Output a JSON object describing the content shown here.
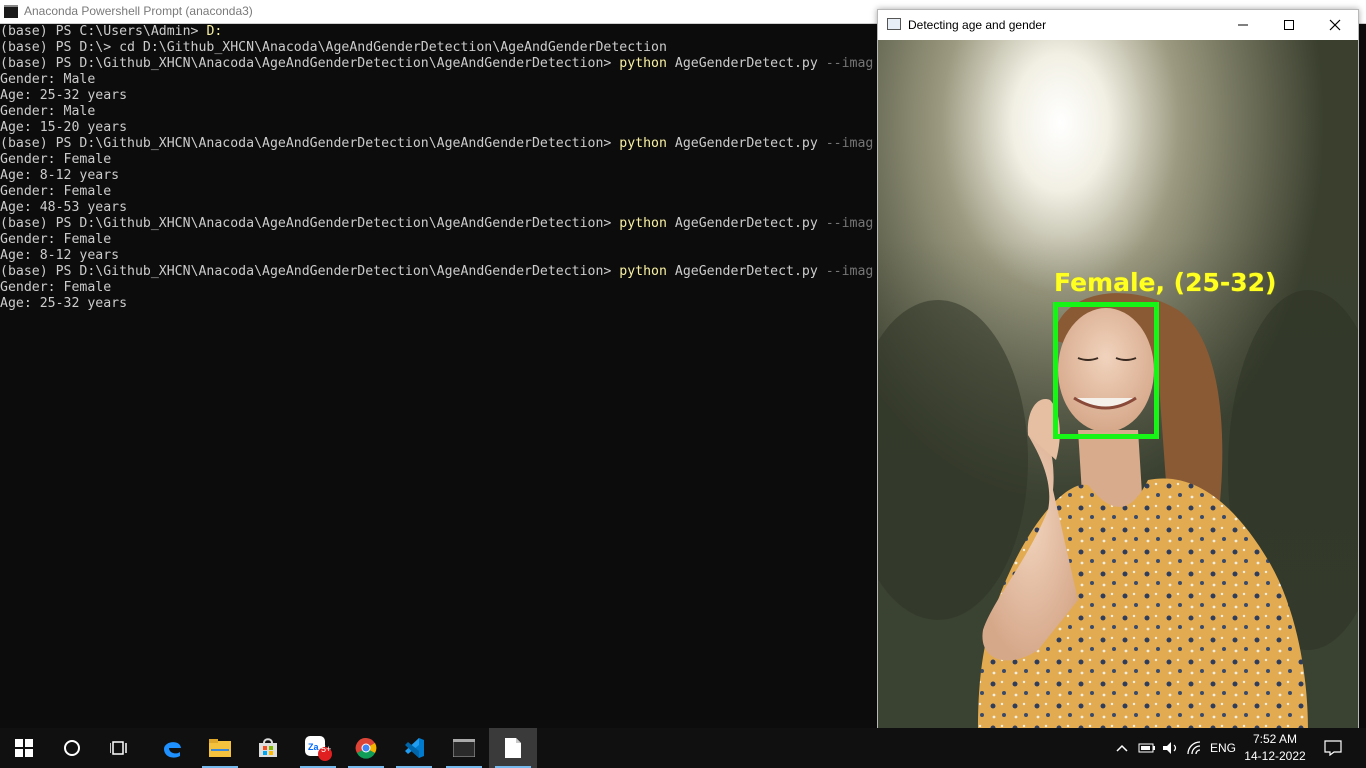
{
  "terminal": {
    "title": "Anaconda Powershell Prompt (anaconda3)",
    "lines": [
      {
        "text": "(base) PS C:\\Users\\Admin> ",
        "cmd": "D:",
        "rest": "",
        "arg": ""
      },
      {
        "text": "(base) PS D:\\> cd D:\\Github_XHCN\\Anacoda\\AgeAndGenderDetection\\AgeAndGenderDetection",
        "cmd": "",
        "rest": "",
        "arg": ""
      },
      {
        "text": "(base) PS D:\\Github_XHCN\\Anacoda\\AgeAndGenderDetection\\AgeAndGenderDetection> ",
        "cmd": "python",
        "rest": " AgeGenderDetect.py ",
        "arg": "--imag"
      },
      {
        "text": "Gender: Male",
        "cmd": "",
        "rest": "",
        "arg": ""
      },
      {
        "text": "Age: 25-32 years",
        "cmd": "",
        "rest": "",
        "arg": ""
      },
      {
        "text": "Gender: Male",
        "cmd": "",
        "rest": "",
        "arg": ""
      },
      {
        "text": "Age: 15-20 years",
        "cmd": "",
        "rest": "",
        "arg": ""
      },
      {
        "text": "(base) PS D:\\Github_XHCN\\Anacoda\\AgeAndGenderDetection\\AgeAndGenderDetection> ",
        "cmd": "python",
        "rest": " AgeGenderDetect.py ",
        "arg": "--imag"
      },
      {
        "text": "Gender: Female",
        "cmd": "",
        "rest": "",
        "arg": ""
      },
      {
        "text": "Age: 8-12 years",
        "cmd": "",
        "rest": "",
        "arg": ""
      },
      {
        "text": "Gender: Female",
        "cmd": "",
        "rest": "",
        "arg": ""
      },
      {
        "text": "Age: 48-53 years",
        "cmd": "",
        "rest": "",
        "arg": ""
      },
      {
        "text": "(base) PS D:\\Github_XHCN\\Anacoda\\AgeAndGenderDetection\\AgeAndGenderDetection> ",
        "cmd": "python",
        "rest": " AgeGenderDetect.py ",
        "arg": "--imag"
      },
      {
        "text": "Gender: Female",
        "cmd": "",
        "rest": "",
        "arg": ""
      },
      {
        "text": "Age: 8-12 years",
        "cmd": "",
        "rest": "",
        "arg": ""
      },
      {
        "text": "(base) PS D:\\Github_XHCN\\Anacoda\\AgeAndGenderDetection\\AgeAndGenderDetection> ",
        "cmd": "python",
        "rest": " AgeGenderDetect.py ",
        "arg": "--imag"
      },
      {
        "text": "Gender: Female",
        "cmd": "",
        "rest": "",
        "arg": ""
      },
      {
        "text": "Age: 25-32 years",
        "cmd": "",
        "rest": "",
        "arg": ""
      }
    ]
  },
  "viewer": {
    "title": "Detecting age and gender",
    "detection_label": "Female, (25-32)",
    "colors": {
      "box": "#16f516",
      "label": "#ffff22"
    }
  },
  "taskbar": {
    "icons": [
      "windows-start-icon",
      "cortana-search-icon",
      "task-view-icon",
      "edge-icon",
      "file-explorer-icon",
      "store-icon",
      "zalo-icon",
      "chrome-icon",
      "vscode-icon",
      "terminal-icon",
      "notepad-icon"
    ],
    "zalo_badge": "5+",
    "language": "ENG",
    "time": "7:52 AM",
    "date": "14-12-2022"
  }
}
